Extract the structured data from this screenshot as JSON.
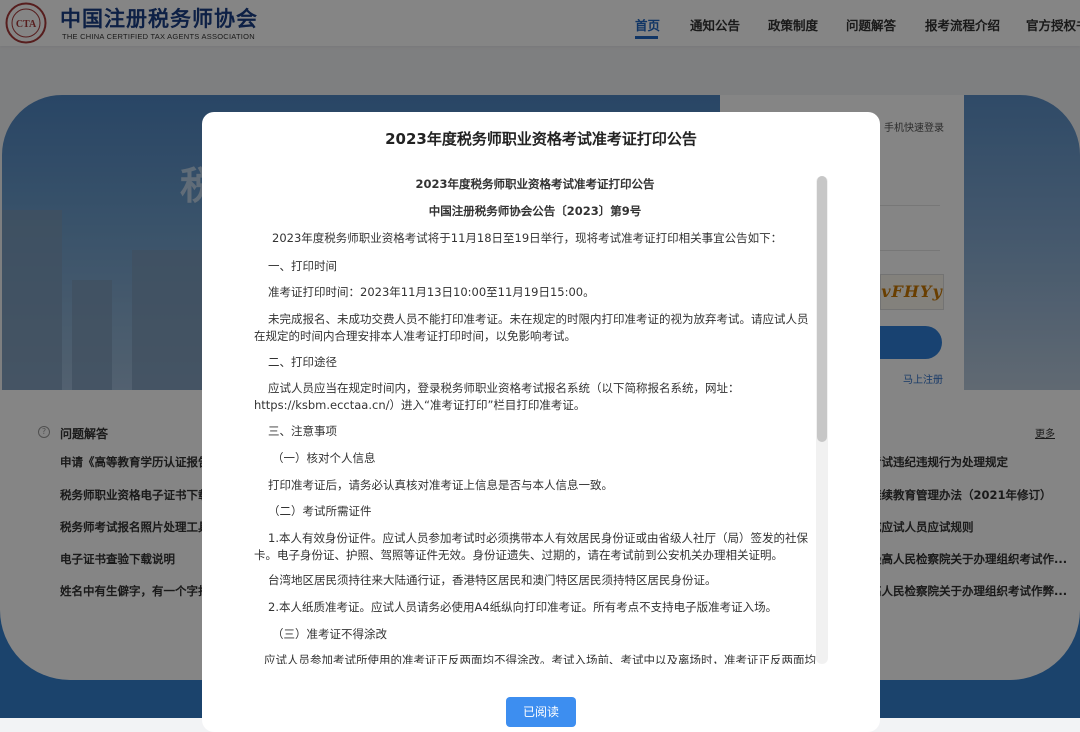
{
  "header": {
    "logo_cn": "中国注册税务师协会",
    "logo_en": "THE CHINA CERTIFIED TAX AGENTS ASSOCIATION",
    "logo_seal_text": "CTA",
    "nav": [
      {
        "label": "首页",
        "active": true
      },
      {
        "label": "通知公告",
        "active": false
      },
      {
        "label": "政策制度",
        "active": false
      },
      {
        "label": "问题解答",
        "active": false
      },
      {
        "label": "报考流程介绍",
        "active": false
      },
      {
        "label": "官方授权书",
        "active": false
      }
    ]
  },
  "background": {
    "banner_ghost_text": "税",
    "login_tab": "手机快速登录",
    "captcha": "vFHYy",
    "register_link": "马上注册",
    "qa_section_title": "问题解答",
    "qa_more": "更多",
    "qa_items": [
      "申请《高等教育学历认证报告",
      "税务师职业资格电子证书下载",
      "税务师考试报名照片处理工具",
      "电子证书查验下载说明",
      "姓名中有生僻字，有一个字打"
    ],
    "news_items": [
      "考试违纪违规行为处理规定",
      "继续教育管理办法（2021年修订）",
      "成应试人员应试规则",
      "最高人民检察院关于办理组织考试作...",
      "高人民检察院关于办理组织考试作弊..."
    ]
  },
  "modal": {
    "title": "2023年度税务师职业资格考试准考证打印公告",
    "heading": "2023年度税务师职业资格考试准考证打印公告",
    "subheading": "中国注册税务师协会公告〔2023〕第9号",
    "paragraphs": [
      "2023年度税务师职业资格考试将于11月18日至19日举行，现将考试准考证打印相关事宜公告如下：",
      "一、打印时间",
      "准考证打印时间：2023年11月13日10:00至11月19日15:00。",
      "未完成报名、未成功交费人员不能打印准考证。未在规定的时限内打印准考证的视为放弃考试。请应试人员在规定的时间内合理安排本人准考证打印时间，以免影响考试。",
      "二、打印途径",
      "应试人员应当在规定时间内，登录税务师职业资格考试报名系统（以下简称报名系统，网址：https://ksbm.ecctaa.cn/）进入“准考证打印”栏目打印准考证。",
      "三、注意事项",
      "（一）核对个人信息",
      "打印准考证后，请务必认真核对准考证上信息是否与本人信息一致。",
      "（二）考试所需证件",
      "1.本人有效身份证件。应试人员参加考试时必须携带本人有效居民身份证或由省级人社厅（局）签发的社保卡。电子身份证、护照、驾照等证件无效。身份证遗失、过期的，请在考试前到公安机关办理相关证明。",
      "台湾地区居民须持往来大陆通行证，香港特区居民和澳门特区居民须持特区居民身份证。",
      "2.本人纸质准考证。应试人员请务必使用A4纸纵向打印准考证。所有考点不支持电子版准考证入场。",
      "（三）准考证不得涂改",
      "应试人员参加考试所使用的准考证正反两面均不得涂改。考试入场前、考试中以及离场时，准考证正反两面均"
    ],
    "read_button": "已阅读"
  }
}
